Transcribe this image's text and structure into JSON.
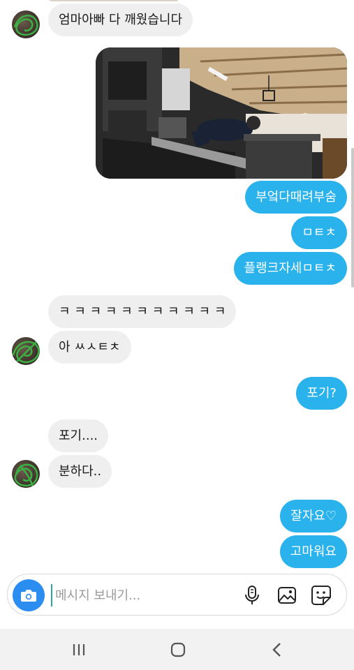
{
  "messages": {
    "m1": "엄마아빠 다 깨웠습니다",
    "m2": "부엌다때려부숨",
    "m3": "ㅁㅌㅊ",
    "m4": "플랭크자세ㅁㅌㅊ",
    "m5": "ㅋ ㅋ ㅋ  ㅋ ㅋ ㅋ ㅋ ㅋ ㅋ ㅋ  ㅋ",
    "m6": "아 ㅆㅅㅌㅊ",
    "m7": "포기?",
    "m8": "포기....",
    "m9": "분하다..",
    "m10": "잘자요♡",
    "m11": "고마워요"
  },
  "composer": {
    "placeholder": "메시지 보내기...",
    "icons": [
      "camera-icon",
      "microphone-icon",
      "gallery-icon",
      "sticker-icon"
    ]
  },
  "navigation": {
    "icons": [
      "recent-apps-icon",
      "home-icon",
      "back-icon"
    ]
  },
  "colors": {
    "outgoing_bubble": "#29b2ec",
    "incoming_bubble": "#efefef",
    "camera_button": "#2c8df0"
  }
}
